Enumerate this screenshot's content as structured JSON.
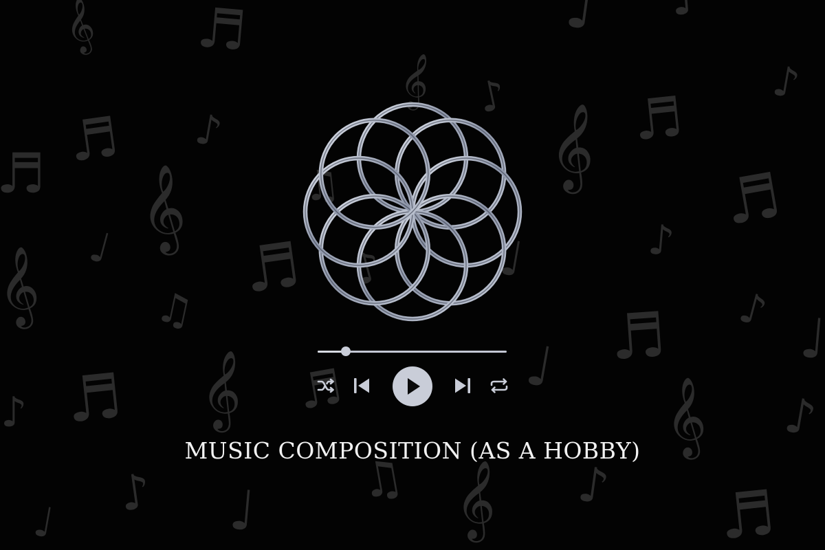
{
  "colors": {
    "background": "#030303",
    "note_pattern": "#2b2b2b",
    "accent": "#c9cdd8",
    "title": "#f2f2f2"
  },
  "background": {
    "pattern_icon": "music-notes-pattern"
  },
  "emblem": {
    "icon": "flower-of-life-icon"
  },
  "player": {
    "progress": 0.15,
    "controls": [
      {
        "name": "shuffle-button",
        "icon": "shuffle-icon"
      },
      {
        "name": "previous-button",
        "icon": "skip-previous-icon"
      },
      {
        "name": "play-button",
        "icon": "play-icon"
      },
      {
        "name": "next-button",
        "icon": "skip-next-icon"
      },
      {
        "name": "repeat-button",
        "icon": "repeat-icon"
      }
    ]
  },
  "title": "MUSIC COMPOSITION (AS A HOBBY)"
}
